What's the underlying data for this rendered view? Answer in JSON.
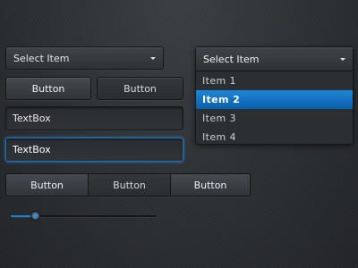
{
  "left_combobox": {
    "label": "Select Item",
    "icon": "chevron-down-icon"
  },
  "buttons_row": [
    {
      "label": "Button"
    },
    {
      "label": "Button"
    }
  ],
  "textboxes": [
    {
      "value": "TextBox"
    },
    {
      "value": "TextBox"
    }
  ],
  "segmented": [
    {
      "label": "Button"
    },
    {
      "label": "Button"
    },
    {
      "label": "Button"
    }
  ],
  "slider": {
    "value_fraction": 0.17
  },
  "dropdown": {
    "label": "Select Item",
    "icon": "chevron-down-icon",
    "items": [
      {
        "label": "Item 1"
      },
      {
        "label": "Item 2"
      },
      {
        "label": "Item 3"
      },
      {
        "label": "Item 4"
      }
    ],
    "selected_index": 1
  },
  "colors": {
    "accent": "#0c6fc0",
    "background": "#2e3134"
  }
}
